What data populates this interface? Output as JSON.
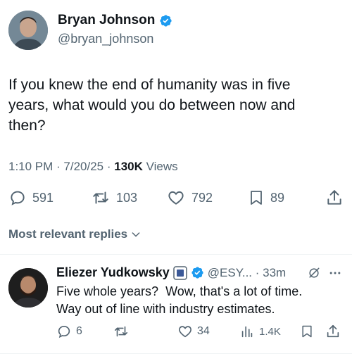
{
  "tweet": {
    "author_name": "Bryan Johnson",
    "author_handle": "@bryan_johnson",
    "text_lines": [
      "If you knew the end of humanity was in five",
      "years, what would you do between now and",
      "then?"
    ],
    "time": "1:10 PM · 7/20/25 · ",
    "views_count": "130K",
    "views_label": " Views",
    "metrics": {
      "replies": "591",
      "reposts": "103",
      "likes": "792",
      "bookmarks": "89"
    }
  },
  "replies_filter": {
    "label": "Most relevant replies"
  },
  "reply": {
    "author_name": "Eliezer Yudkowsky",
    "handle_time": "@ESY... · 33m",
    "text_lines": [
      "Five whole years?  Wow, that's a lot of time.",
      "Way out of line with industry estimates."
    ],
    "metrics": {
      "replies": "6",
      "likes": "34",
      "views": "1.4K"
    }
  },
  "colors": {
    "verified": "#1d9bf0",
    "text": "#0f1419",
    "secondary": "#536471",
    "divider": "#eff3f4"
  }
}
